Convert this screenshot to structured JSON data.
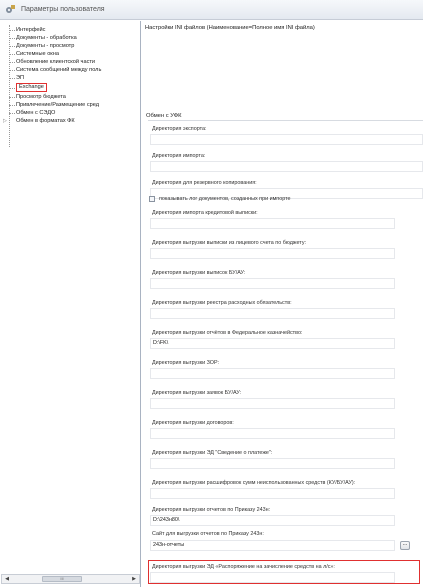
{
  "window": {
    "title": "Параметры пользователя"
  },
  "tree": {
    "items": [
      {
        "label": "Интерфейс",
        "selected": false,
        "expandable": false
      },
      {
        "label": "Документы - обработка",
        "selected": false,
        "expandable": false
      },
      {
        "label": "Документы - просмотр",
        "selected": false,
        "expandable": false
      },
      {
        "label": "Системные окна",
        "selected": false,
        "expandable": false
      },
      {
        "label": "Обновление клиентской части",
        "selected": false,
        "expandable": false
      },
      {
        "label": "Система сообщений между поль",
        "selected": false,
        "expandable": false
      },
      {
        "label": "ЭП",
        "selected": false,
        "expandable": false
      },
      {
        "label": "Exchange",
        "selected": true,
        "expandable": false
      },
      {
        "label": "Просмотр бюджета",
        "selected": false,
        "expandable": false
      },
      {
        "label": "Привлечение/Размещение сред",
        "selected": false,
        "expandable": false
      },
      {
        "label": "Обмен с СЭДО",
        "selected": false,
        "expandable": false
      },
      {
        "label": "Обмен в форматах ФК",
        "selected": false,
        "expandable": true
      }
    ],
    "scroll_thumb": "III"
  },
  "main": {
    "ini_header": "Настройки INI файлов (Наименование=Полное имя INI файла)",
    "ufk_section": "Обмен с УФК",
    "export_dir_label": "Директория экспорта:",
    "export_dir_value": "",
    "import_dir_label": "Директория импорта:",
    "import_dir_value": "",
    "backup_dir_label": "Директория для резервного копирования:",
    "backup_dir_value": "",
    "show_log_label": "показывать лог документов, созданных при импорте",
    "show_log_checked": false,
    "fields": [
      {
        "label": "Директория импорта кредитовой выписки:",
        "value": ""
      },
      {
        "label": "Директория выгрузки выписки из лицевого счета по бюджету:",
        "value": ""
      },
      {
        "label": "Директория выгрузки выписок БУ/АУ:",
        "value": ""
      },
      {
        "label": "Директория выгрузки реестра расходных обязательств:",
        "value": ""
      },
      {
        "label": "Директория выгрузки отчётов в Федеральное казначейство:",
        "value": "D:\\FK\\"
      },
      {
        "label": "Директория выгрузки ЗОР:",
        "value": ""
      },
      {
        "label": "Директория выгрузки заявок БУ/АУ:",
        "value": ""
      },
      {
        "label": "Директория выгрузки договоров:",
        "value": ""
      },
      {
        "label": "Директория выгрузки ЭД \"Сведение о платеже\":",
        "value": ""
      },
      {
        "label": "Директория выгрузки расшифровок сумм неиспользованных средств (КУ/БУ/АУ):",
        "value": ""
      },
      {
        "label": "Директория выгрузки отчетов по Приказу 243н:",
        "value": "D:\\243н80\\"
      }
    ],
    "site_label": "Сайт для выгрузки отчетов по Приказу 243н:",
    "site_value": "243н-отчеты",
    "site_button": "...",
    "last_label": "Директория выгрузки ЭД «Распоряжение на зачисление средств на л/с»:",
    "last_value": ""
  }
}
